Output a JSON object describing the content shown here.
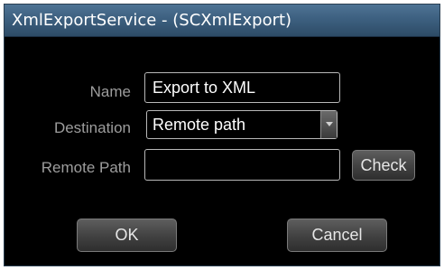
{
  "window": {
    "title": "XmlExportService - (SCXmlExport)"
  },
  "form": {
    "name": {
      "label": "Name",
      "value": "Export to XML"
    },
    "destination": {
      "label": "Destination",
      "selected": "Remote path",
      "arrow_icon": "chevron-down-icon"
    },
    "remote_path": {
      "label": "Remote Path",
      "value": ""
    },
    "check_button": "Check"
  },
  "buttons": {
    "ok": "OK",
    "cancel": "Cancel"
  },
  "colors": {
    "title_bar": "#3d6080",
    "background": "#000000",
    "label_text": "#9d9d9d",
    "field_border": "#b8b8b8"
  }
}
